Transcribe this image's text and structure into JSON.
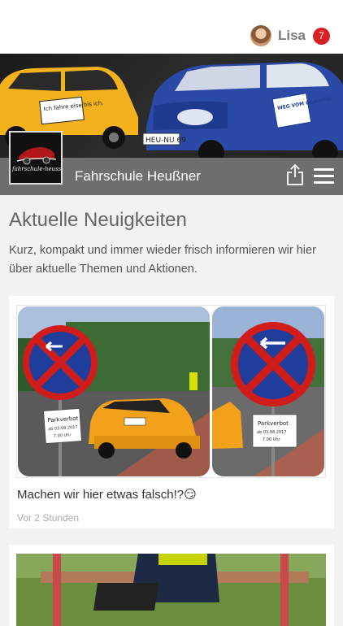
{
  "user": {
    "name": "Lisa",
    "notifications": "7"
  },
  "hero": {
    "yellow_car_sign": "Ich fahre eise bis ich.",
    "blue_car_sign": "WEG VOM GEHWEG!",
    "plate": "HEU-NU 69"
  },
  "brand": {
    "name": "Fahrschule Heußner",
    "logo_text": "fahrschule-heussner.de"
  },
  "section": {
    "title": "Aktuelle Neuigkeiten",
    "description": "Kurz, kompakt und immer wieder frisch informieren wir hier über aktuelle Themen und Aktionen."
  },
  "posts": [
    {
      "text": "Machen wir hier etwas falsch!?😏",
      "time": "Vor 2 Stunden",
      "sign_left": {
        "title": "Parkverbot",
        "date": "ab 03.08.2017",
        "time": "7.00 Uhr"
      },
      "sign_right": {
        "title": "Parkverbot",
        "date": "ab 03.08.2017",
        "time": "7.00 Uhr"
      }
    }
  ],
  "colors": {
    "badge": "#d81f26",
    "brandbar": "#6e6e6e",
    "yellow": "#f3b21b",
    "blue": "#2b4aa8"
  },
  "icons": [
    "avatar",
    "share-icon",
    "menu-icon"
  ]
}
